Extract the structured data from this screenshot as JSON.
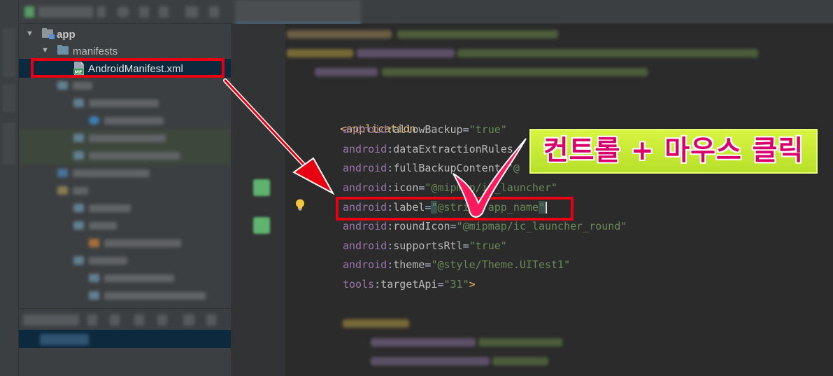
{
  "project_tree": {
    "root": {
      "label": "app"
    },
    "manifests": {
      "label": "manifests"
    },
    "manifest_file": {
      "label": "AndroidManifest.xml",
      "icon_badge": "MF"
    }
  },
  "editor": {
    "lines": {
      "application_open": {
        "tag": "<application"
      },
      "allow_backup": {
        "ns": "android",
        "attr": "allowBackup",
        "value": "\"true\""
      },
      "data_extraction": {
        "ns": "android",
        "attr": "dataExtractionRules"
      },
      "full_backup": {
        "ns": "android",
        "attr": "fullBackupContent",
        "value": "=\"@"
      },
      "icon": {
        "ns": "android",
        "attr": "icon",
        "value": "\"@mipmap/ic_launcher\""
      },
      "label": {
        "ns": "android",
        "attr": "label",
        "value": "@string/app_name",
        "quote": "\""
      },
      "round_icon": {
        "ns": "android",
        "attr": "roundIcon",
        "value": "\"@mipmap/ic_launcher_round\""
      },
      "supports_rtl": {
        "ns": "android",
        "attr": "supportsRtl",
        "value": "\"true\""
      },
      "theme": {
        "ns": "android",
        "attr": "theme",
        "value": "\"@style/Theme.UITest1\""
      },
      "target_api": {
        "ns": "tools",
        "attr": "targetApi",
        "value": "\"31\"",
        "close": ">"
      }
    },
    "colon": ":",
    "equals": "="
  },
  "annotation": {
    "callout_text": "컨트롤 + 마우스 클릭",
    "highlight_color": "#e60012",
    "callout_bg": "#c6ea33",
    "callout_text_color": "#d9006c"
  },
  "icons": {
    "bulb": "lightbulb-icon",
    "check": "checkmark-icon",
    "folder": "folder-icon",
    "manifest": "manifest-file-icon"
  }
}
